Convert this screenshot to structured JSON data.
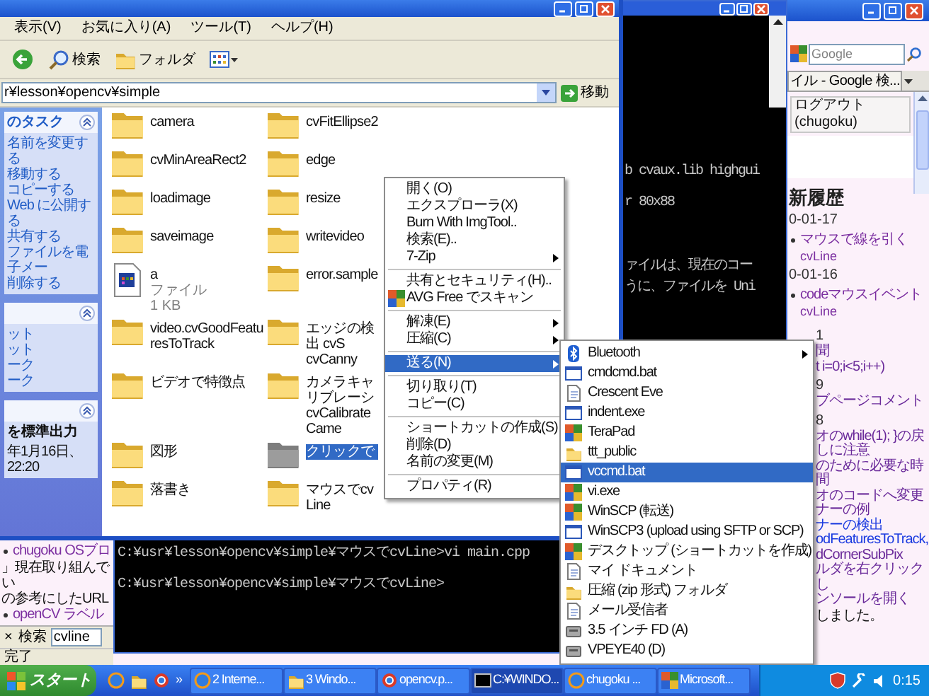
{
  "browser": {
    "left_entries": [
      {
        "kind": "bullet_link",
        "text": "chugoku OSブロ"
      },
      {
        "kind": "text",
        "text": "」現在取り組んでい"
      },
      {
        "kind": "text",
        "text": "の参考にしたURL"
      },
      {
        "kind": "bullet_link",
        "text": "openCV ラベル"
      }
    ],
    "find_bar": {
      "close": "×",
      "label": "検索",
      "value": "cvline"
    },
    "status": "完了",
    "search_placeholder": "Google",
    "tab": "イル - Google 検...",
    "logout": "ログアウト (chugoku)",
    "heading": "新履歴",
    "entries": [
      {
        "kind": "date",
        "text": "0-01-17"
      },
      {
        "kind": "bullet_link",
        "text": "マウスで線を引く"
      },
      {
        "kind": "sub",
        "text": "cvLine"
      },
      {
        "kind": "date",
        "text": "0-01-16"
      },
      {
        "kind": "bullet_link",
        "text": "codeマウスイベント"
      },
      {
        "kind": "sub",
        "text": "cvLine"
      }
    ],
    "more_entries": [
      {
        "kind": "date",
        "text": "1"
      },
      {
        "kind": "link",
        "text": "聞"
      },
      {
        "kind": "link",
        "text": "t i=0;i<5;i++)"
      },
      {
        "kind": "date",
        "text": "9"
      },
      {
        "kind": "link",
        "text": "ブページコメント"
      },
      {
        "kind": "date",
        "text": "8"
      },
      {
        "kind": "link",
        "text": "オのwhile(1); }の戻"
      },
      {
        "kind": "link",
        "text": "しに注意"
      },
      {
        "kind": "link",
        "text": "のために必要な時間"
      },
      {
        "kind": "link",
        "text": "オのコードへ変更"
      },
      {
        "kind": "link",
        "text": "ナーの例"
      },
      {
        "kind": "newlink",
        "text": "ナーの検出"
      },
      {
        "kind": "newlink",
        "text": "odFeaturesToTrack,"
      },
      {
        "kind": "link",
        "text": "dCornerSubPix"
      },
      {
        "kind": "link",
        "text": "ルダを右クリックし"
      },
      {
        "kind": "link",
        "text": "ンソールを開く"
      },
      {
        "kind": "text",
        "text": "しました。"
      }
    ]
  },
  "console": {
    "top_groups": [
      [
        "b cvaux.lib highgui",
        "r 80x88"
      ],
      [
        "ァイルは、現在のコー",
        "うに、ファイルを Uni"
      ]
    ],
    "bottom_lines": [
      "C:¥usr¥lesson¥opencv¥simple¥マウスでcvLine>vi main.cpp",
      "C:¥usr¥lesson¥opencv¥simple¥マウスでcvLine>"
    ]
  },
  "explorer": {
    "menu": [
      "表示(V)",
      "お気に入り(A)",
      "ツール(T)",
      "ヘルプ(H)"
    ],
    "toolbar": [
      "検索",
      "フォルダ"
    ],
    "address": "r¥lesson¥opencv¥simple",
    "go": "移動",
    "panels": [
      {
        "kind": "tasks",
        "title": "のタスク",
        "items": [
          "名前を変更する",
          "移動する",
          "コピーする",
          "Web に公開する",
          "共有する",
          "ファイルを電子メー",
          "削除する"
        ]
      },
      {
        "kind": "tasks",
        "items": [
          "ット",
          "ット",
          "ーク",
          "ーク"
        ]
      },
      {
        "kind": "details",
        "heading": "を標準出力",
        "detail": "年1月16日、22:20"
      }
    ],
    "files": [
      {
        "kind": "folder",
        "name": "camera",
        "selected": false
      },
      {
        "kind": "folder",
        "name": "cvFitEllipse2",
        "selected": false
      },
      {
        "kind": "folder",
        "name": "cvMinAreaRect2",
        "selected": false
      },
      {
        "kind": "folder",
        "name": "edge",
        "selected": false
      },
      {
        "kind": "folder",
        "name": "loadimage",
        "selected": false
      },
      {
        "kind": "folder",
        "name": "resize",
        "selected": false
      },
      {
        "kind": "folder",
        "name": "saveimage",
        "selected": false
      },
      {
        "kind": "folder",
        "name": "writevideo",
        "selected": false
      },
      {
        "kind": "file",
        "name": "a",
        "details": "ファイル\n1 KB",
        "selected": false
      },
      {
        "kind": "folder",
        "name": "error.sample",
        "selected": false
      },
      {
        "kind": "folder",
        "name": "video.cvGoodFeaturesToTrack",
        "selected": false
      },
      {
        "kind": "folder",
        "name": "エッジの検出 cvS\ncvCanny",
        "selected": false
      },
      {
        "kind": "folder",
        "name": "ビデオで特徴点",
        "selected": false
      },
      {
        "kind": "folder",
        "name": "カメラキャリブレーシ\ncvCalibrateCame",
        "selected": false
      },
      {
        "kind": "folder",
        "name": "図形",
        "selected": false
      },
      {
        "kind": "folder",
        "name": "クリックで",
        "selected": true
      },
      {
        "kind": "folder",
        "name": "落書き",
        "selected": false
      },
      {
        "kind": "folder",
        "name": "マウスでcvLine",
        "selected": false
      }
    ]
  },
  "context_menu": [
    {
      "kind": "item",
      "label": "開く(O)",
      "submenu": false,
      "selected": false
    },
    {
      "kind": "item",
      "label": "エクスプローラ(X)",
      "submenu": false,
      "selected": false
    },
    {
      "kind": "item",
      "label": "Burn With ImgTool..",
      "submenu": false,
      "selected": false
    },
    {
      "kind": "item",
      "label": "検索(E)..",
      "submenu": false,
      "selected": false
    },
    {
      "kind": "item",
      "label": "7-Zip",
      "submenu": true,
      "selected": false
    },
    {
      "kind": "separator"
    },
    {
      "kind": "item",
      "label": "共有とセキュリティ(H)..",
      "submenu": false,
      "selected": false
    },
    {
      "kind": "icon_item",
      "label": "AVG Free でスキャン",
      "submenu": false,
      "selected": false
    },
    {
      "kind": "separator"
    },
    {
      "kind": "item",
      "label": "解凍(E)",
      "submenu": true,
      "selected": false
    },
    {
      "kind": "item",
      "label": "圧縮(C)",
      "submenu": true,
      "selected": false
    },
    {
      "kind": "separator"
    },
    {
      "kind": "item",
      "label": "送る(N)",
      "submenu": true,
      "selected": true
    },
    {
      "kind": "separator"
    },
    {
      "kind": "item",
      "label": "切り取り(T)",
      "submenu": false,
      "selected": false
    },
    {
      "kind": "item",
      "label": "コピー(C)",
      "submenu": false,
      "selected": false
    },
    {
      "kind": "separator"
    },
    {
      "kind": "item",
      "label": "ショートカットの作成(S)",
      "submenu": false,
      "selected": false
    },
    {
      "kind": "item",
      "label": "削除(D)",
      "submenu": false,
      "selected": false
    },
    {
      "kind": "item",
      "label": "名前の変更(M)",
      "submenu": false,
      "selected": false
    },
    {
      "kind": "separator"
    },
    {
      "kind": "item",
      "label": "プロパティ(R)",
      "submenu": false,
      "selected": false
    }
  ],
  "send_to": [
    {
      "kind": "bluetooth",
      "label": "Bluetooth",
      "submenu": true,
      "selected": false
    },
    {
      "kind": "window",
      "label": "cmdcmd.bat",
      "submenu": false,
      "selected": false
    },
    {
      "kind": "document",
      "label": "Crescent Eve",
      "submenu": false,
      "selected": false
    },
    {
      "kind": "window",
      "label": "indent.exe",
      "submenu": false,
      "selected": false
    },
    {
      "kind": "app",
      "label": "TeraPad",
      "submenu": false,
      "selected": false
    },
    {
      "kind": "folder",
      "label": "ttt_public",
      "submenu": false,
      "selected": false
    },
    {
      "kind": "window",
      "label": "vccmd.bat",
      "submenu": false,
      "selected": true
    },
    {
      "kind": "app",
      "label": "vi.exe",
      "submenu": false,
      "selected": false
    },
    {
      "kind": "app",
      "label": "WinSCP (転送)",
      "submenu": false,
      "selected": false
    },
    {
      "kind": "window",
      "label": "WinSCP3 (upload using SFTP or SCP)",
      "submenu": false,
      "selected": false
    },
    {
      "kind": "app",
      "label": "デスクトップ (ショートカットを作成)",
      "submenu": false,
      "selected": false
    },
    {
      "kind": "document",
      "label": "マイ ドキュメント",
      "submenu": false,
      "selected": false
    },
    {
      "kind": "folder",
      "label": "圧縮 (zip 形式) フォルダ",
      "submenu": false,
      "selected": false
    },
    {
      "kind": "document",
      "label": "メール受信者",
      "submenu": false,
      "selected": false
    },
    {
      "kind": "drive",
      "label": "3.5 インチ FD (A)",
      "submenu": false,
      "selected": false
    },
    {
      "kind": "drive",
      "label": "VPEYE40 (D)",
      "submenu": false,
      "selected": false
    }
  ],
  "taskbar": {
    "start": "スタート",
    "more": "»",
    "buttons": [
      {
        "kind": "globe",
        "label": "2 Interne...",
        "selected": false
      },
      {
        "kind": "folder",
        "label": "3 Windo...",
        "selected": false
      },
      {
        "kind": "ring",
        "label": "opencv.p...",
        "selected": false
      },
      {
        "kind": "console",
        "label": "C:¥WINDO...",
        "selected": true
      },
      {
        "kind": "globe",
        "label": "chugoku ...",
        "selected": false
      },
      {
        "kind": "app",
        "label": "Microsoft...",
        "selected": false
      }
    ],
    "clock": "0:15"
  }
}
